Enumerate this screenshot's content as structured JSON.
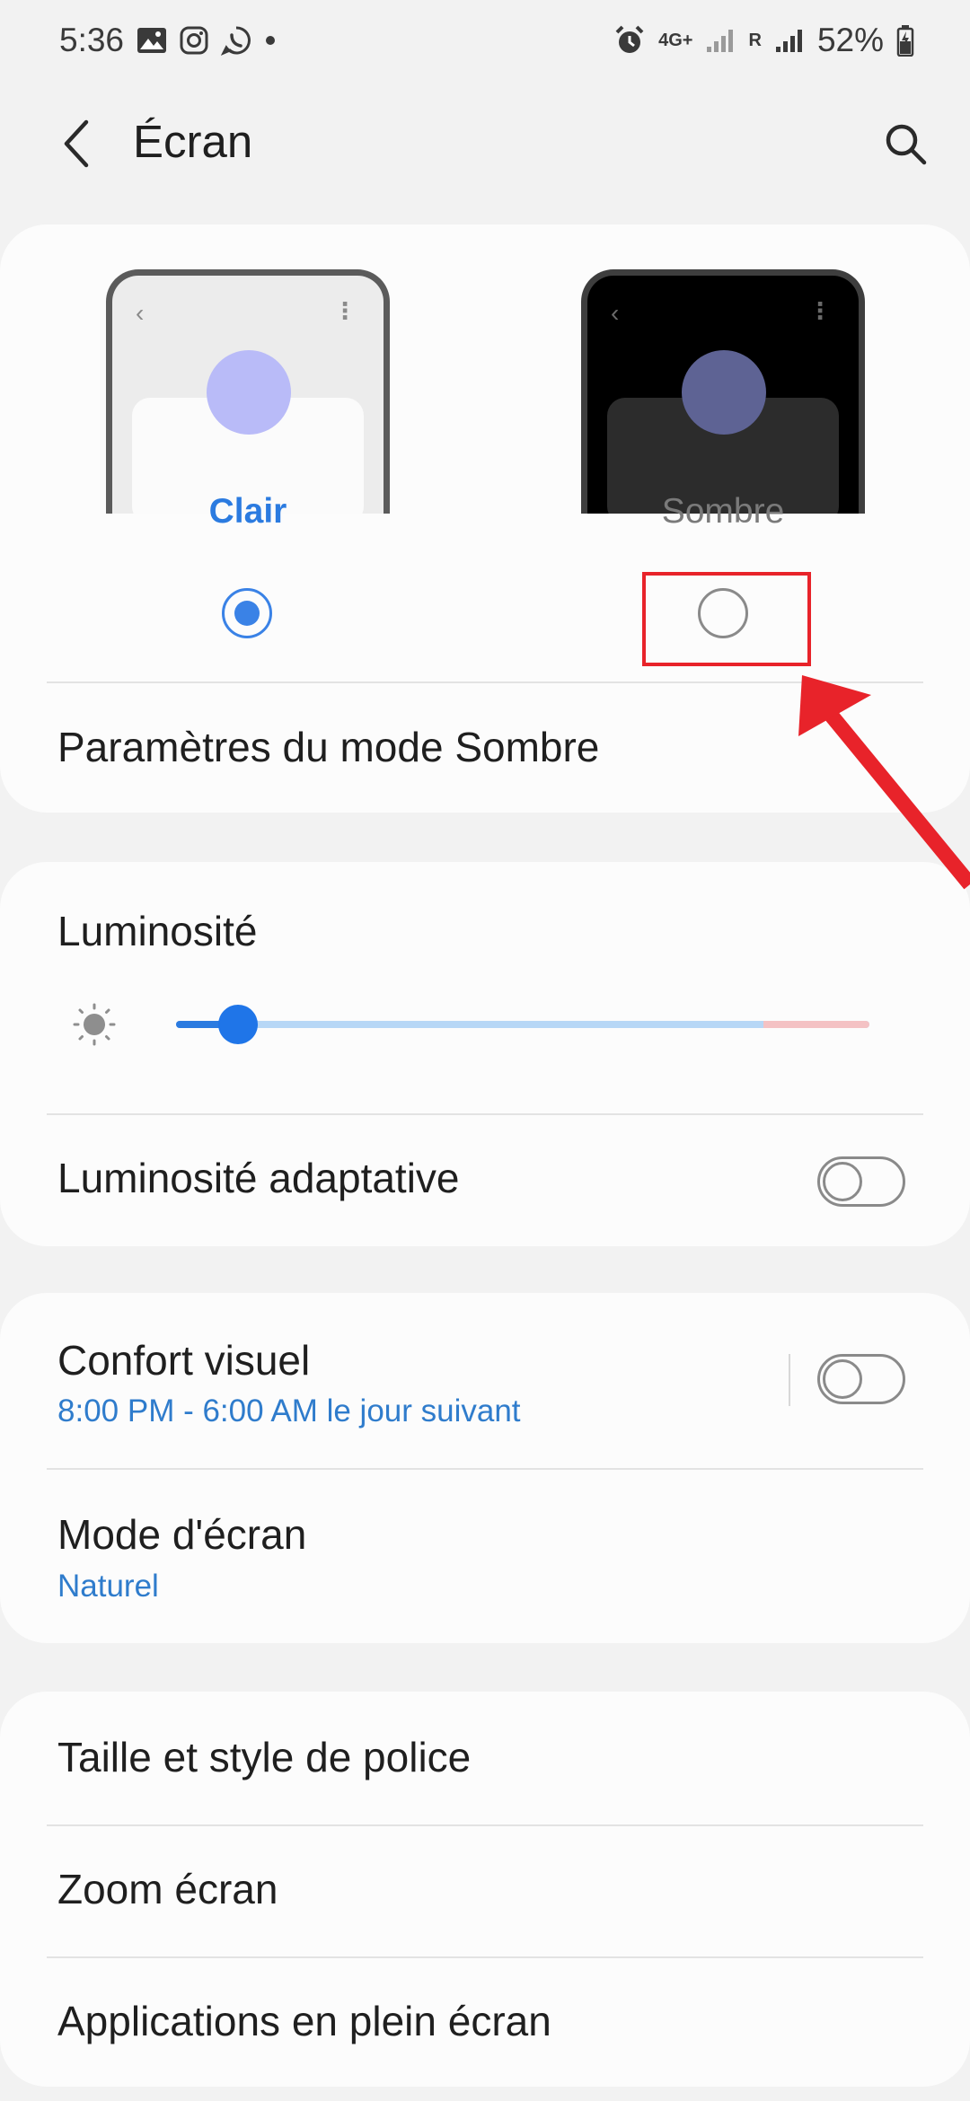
{
  "status_bar": {
    "time": "5:36",
    "notification_icons": [
      "gallery-icon",
      "instagram-icon",
      "whatsapp-icon",
      "dot-icon"
    ],
    "network_label": "4G+",
    "roaming_label": "R",
    "battery": "52%"
  },
  "header": {
    "title": "Écran"
  },
  "theme": {
    "light_label": "Clair",
    "dark_label": "Sombre",
    "selected": "Clair",
    "dark_settings_label": "Paramètres du mode Sombre"
  },
  "brightness": {
    "title": "Luminosité",
    "level": 0.09,
    "adaptive_label": "Luminosité adaptative",
    "adaptive_on": false
  },
  "comfort": {
    "title": "Confort visuel",
    "schedule": "8:00 PM - 6:00 AM le jour suivant",
    "on": false,
    "screen_mode_title": "Mode d'écran",
    "screen_mode_value": "Naturel"
  },
  "misc": {
    "font_label": "Taille et style de police",
    "zoom_label": "Zoom écran",
    "fullscreen_label": "Applications en plein écran"
  },
  "colors": {
    "accent": "#2b7be0",
    "annotation": "#e8232a"
  }
}
